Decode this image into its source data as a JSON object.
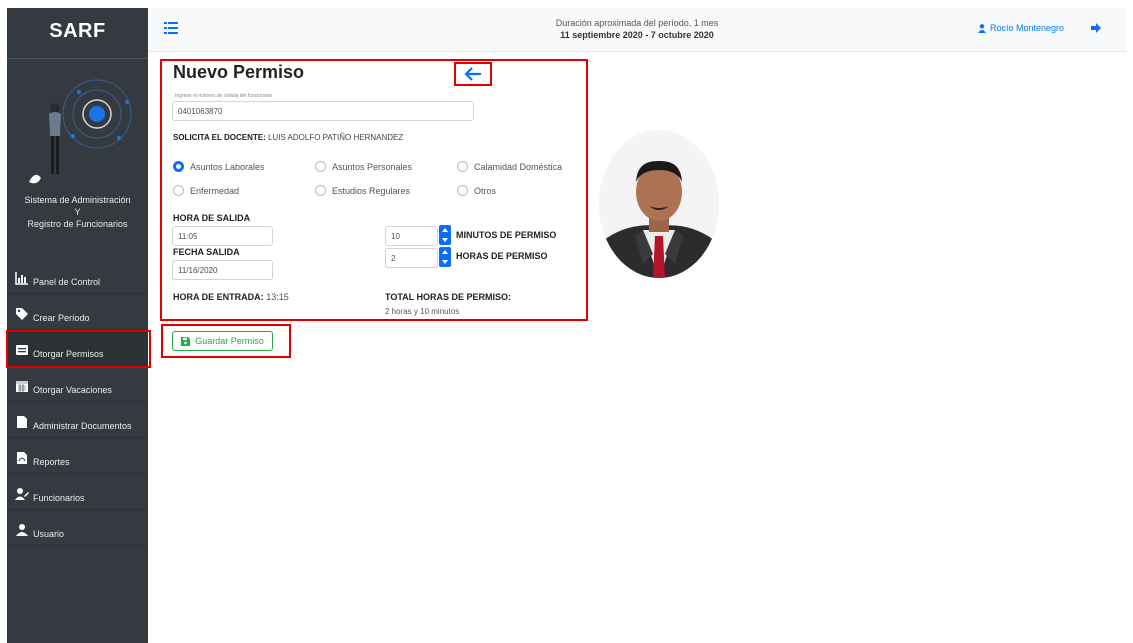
{
  "sidebar": {
    "brand": "SARF",
    "system_title_line1": "Sistema de Administración",
    "system_title_line2": "Y",
    "system_title_line3": "Registro de Funcionarios",
    "items": [
      {
        "label": "Panel de Control",
        "icon": "chart-icon"
      },
      {
        "label": "Crear Período",
        "icon": "tag-icon"
      },
      {
        "label": "Otorgar Permisos",
        "icon": "id-card-icon"
      },
      {
        "label": "Otorgar Vacaciones",
        "icon": "calendar-icon"
      },
      {
        "label": "Administrar Documentos",
        "icon": "file-icon"
      },
      {
        "label": "Reportes",
        "icon": "pdf-file-icon"
      },
      {
        "label": "Funcionarios",
        "icon": "user-edit-icon"
      },
      {
        "label": "Usuario",
        "icon": "user-icon"
      }
    ]
  },
  "topbar": {
    "period_line1": "Duración aproximada del período, 1 mes",
    "period_line2": "11 septiembre 2020 - 7 octubre 2020",
    "user_name": "Rocío Montenegro"
  },
  "form": {
    "title": "Nuevo Permiso",
    "cedula_label": "Ingrese el número de cédula del funcionario",
    "cedula_value": "0401063870",
    "solicita_label": "SOLICITA EL DOCENTE:",
    "solicita_value": "LUIS ADOLFO PATIÑO HERNANDEZ",
    "reasons": [
      {
        "label": "Asuntos Laborales",
        "checked": true
      },
      {
        "label": "Asuntos Personales",
        "checked": false
      },
      {
        "label": "Calamidad Doméstica",
        "checked": false
      },
      {
        "label": "Enfermedad",
        "checked": false
      },
      {
        "label": "Estudios Regulares",
        "checked": false
      },
      {
        "label": "Otros",
        "checked": false
      }
    ],
    "hora_salida_label": "HORA DE SALIDA",
    "hora_salida_value": "11:05",
    "fecha_salida_label": "FECHA SALIDA",
    "fecha_salida_value": "11/16/2020",
    "minutos_value": "10",
    "minutos_label": "MINUTOS DE PERMISO",
    "horas_value": "2",
    "horas_label": "HORAS DE PERMISO",
    "hora_entrada_label": "HORA DE ENTRADA:",
    "hora_entrada_value": "13:15",
    "total_label": "TOTAL HORAS DE PERMISO:",
    "total_value": "2 horas y 10 minutos",
    "save_label": "Guardar Permiso"
  },
  "colors": {
    "sidebar_bg": "#343a40",
    "accent_blue": "#0d6efd",
    "save_green": "#28a745",
    "highlight_red": "#e00000"
  }
}
